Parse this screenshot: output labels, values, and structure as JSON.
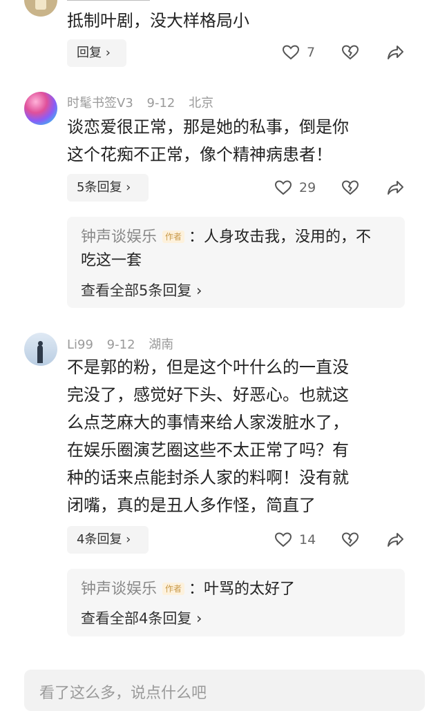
{
  "comments": [
    {
      "text": "抵制叶剧，没大样格局小",
      "reply_label": "回复 ›",
      "likes": "7"
    },
    {
      "user": "时髦书签V3",
      "date": "9-12",
      "location": "北京",
      "text_lines": [
        "谈恋爱很正常，那是她的私事，倒是你",
        "这个花痴不正常，像个精神病患者！"
      ],
      "reply_label": "5条回复 ›",
      "likes": "29",
      "quote": {
        "author": "钟声谈娱乐",
        "badge": "作者",
        "line1": "：人身攻击我，没用的，不",
        "line2": "吃这一套",
        "view_all": "查看全部5条回复 ›"
      }
    },
    {
      "user": "Li99",
      "date": "9-12",
      "location": "湖南",
      "text_lines": [
        "不是郭的粉，但是这个叶什么的一直没",
        "完没了，感觉好下头、好恶心。也就这",
        "么点芝麻大的事情来给人家泼脏水了，",
        "在娱乐圈演艺圈这些不太正常了吗？有",
        "种的话来点能封杀人家的料啊！没有就",
        "闭嘴，真的是丑人多作怪，简直了"
      ],
      "reply_label": "4条回复 ›",
      "likes": "14",
      "quote": {
        "author": "钟声谈娱乐",
        "badge": "作者",
        "line1": "：叶骂的太好了",
        "view_all": "查看全部4条回复 ›"
      }
    }
  ],
  "input": {
    "placeholder": "看了这么多，说点什么吧"
  },
  "icons": [
    "heart-icon",
    "broken-heart-icon",
    "share-icon",
    "chevron-right-icon"
  ],
  "colors": {
    "meta_gray": "#9a9a9a",
    "badge_bg": "#fdf1dc",
    "badge_text": "#c99a4a",
    "quote_bg": "#f6f6f6"
  }
}
